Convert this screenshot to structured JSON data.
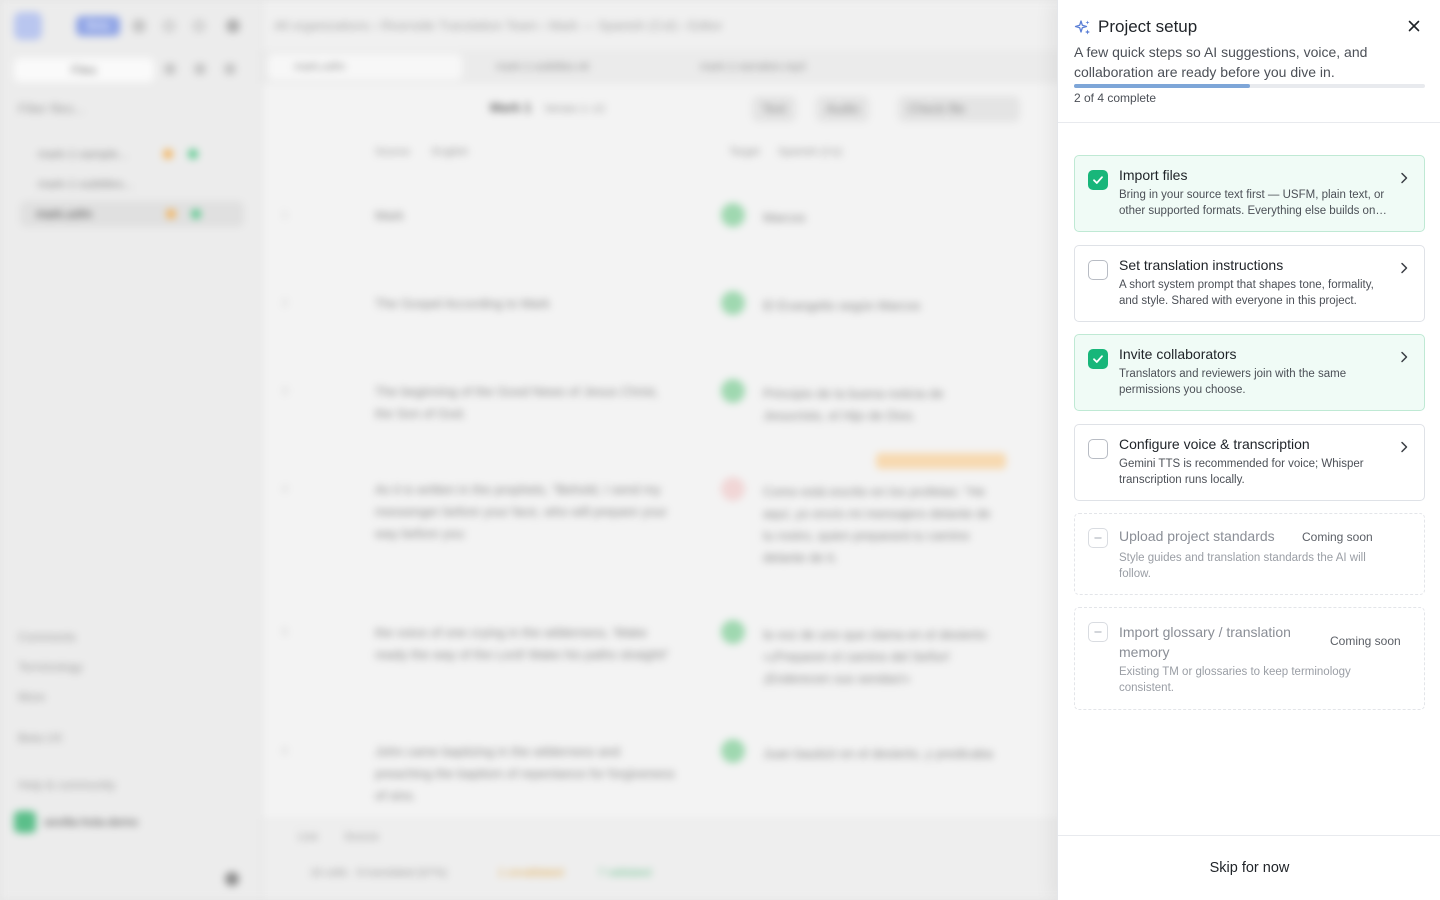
{
  "background": {
    "sidebar": {
      "badge": "Beta",
      "files_button": "Files",
      "filter_placeholder": "Filter files...",
      "files": [
        "mark-1-sample...",
        "mark-1-subtitles...",
        "mark.usfm"
      ],
      "links": [
        "Comments",
        "Terminology",
        "More",
        "Beta UX",
        "Help & community"
      ],
      "org": "sevilla-hola-demo"
    },
    "breadcrumbs": "All organizations  ›  Riverside Translation Team  ›  Mark — Spanish (Col)  ›  Editor",
    "tabs": [
      "mark.usfm",
      "mark-1-subtitles.vtt",
      "mark-1-narration.mp3"
    ],
    "toolbar": {
      "chapter": "Mark 1",
      "verses": "Verses 1–12",
      "text_chip": "Text",
      "audio_chip": "Audio",
      "check_chip": "Check file"
    },
    "columns": {
      "source": "Source",
      "source_lang": "English",
      "target": "Target",
      "target_lang": "Spanish (Co)"
    },
    "rows": [
      {
        "num": "1",
        "source": "Mark",
        "target": "Marcos"
      },
      {
        "num": "2",
        "source": "The Gospel According to Mark",
        "target": "El Evangelio según Marcos"
      },
      {
        "num": "3",
        "source": "The beginning of the Good News of Jesus Christ, the Son of God.",
        "target": "Principio de la buena noticia de Jesucristo, el Hijo de Dios."
      },
      {
        "num": "4",
        "source": "As it is written in the prophets, \"Behold, I send my messenger before your face, who will prepare your way before you:",
        "target": "Como está escrito en los profetas: \"He aquí, yo envío mi mensajero delante de tu rostro, quien preparará tu camino delante de ti."
      },
      {
        "num": "5",
        "source": "the voice of one crying in the wilderness, 'Make ready the way of the Lord! Make his paths straight!'",
        "target": "la voz de uno que clama en el desierto: «¡Preparen el camino del Señor! ¡Enderecen sus sendas!»"
      },
      {
        "num": "6",
        "source": "John came baptizing in the wilderness and preaching the baptism of repentance for forgiveness of sins.",
        "target": "Juan bautizó en el desierto, y predicaba el bautismo"
      }
    ],
    "footer": {
      "mode": "Live",
      "source": "Source",
      "stats": "16 cells · 8 translated (67%)",
      "unvalidated": "1 unvalidated",
      "validated": "7 validated"
    }
  },
  "panel": {
    "title": "Project setup",
    "subtitle": "A few quick steps so AI suggestions, voice, and collaboration are ready before you dive in.",
    "progress_fraction": 0.5,
    "progress_text": "2 of 4 complete",
    "steps": [
      {
        "title": "Import files",
        "desc": "Bring in your source text first — USFM, plain text, or other supported formats. Everything else builds on top of this.",
        "done": true
      },
      {
        "title": "Set translation instructions",
        "desc": "A short system prompt that shapes tone, formality, and style. Shared with everyone in this project.",
        "done": false
      },
      {
        "title": "Invite collaborators",
        "desc": "Translators and reviewers join with the same permissions you choose.",
        "done": true
      },
      {
        "title": "Configure voice & transcription",
        "desc": "Gemini TTS is recommended for voice; Whisper transcription runs locally.",
        "done": false
      }
    ],
    "coming_soon": [
      {
        "title": "Upload project standards",
        "tag": "Coming soon",
        "desc": "Style guides and translation standards the AI will follow."
      },
      {
        "title": "Import glossary / translation memory",
        "tag": "Coming soon",
        "desc": "Existing TM or glossaries to keep terminology consistent."
      }
    ],
    "skip_label": "Skip for now"
  },
  "colors": {
    "accent_green": "#18b67a",
    "progress_blue": "#7ea6d8",
    "done_bg": "#f0fbf6"
  },
  "icons": [
    "sparkle-icon",
    "close-icon",
    "check-icon",
    "chevron-right-icon"
  ]
}
